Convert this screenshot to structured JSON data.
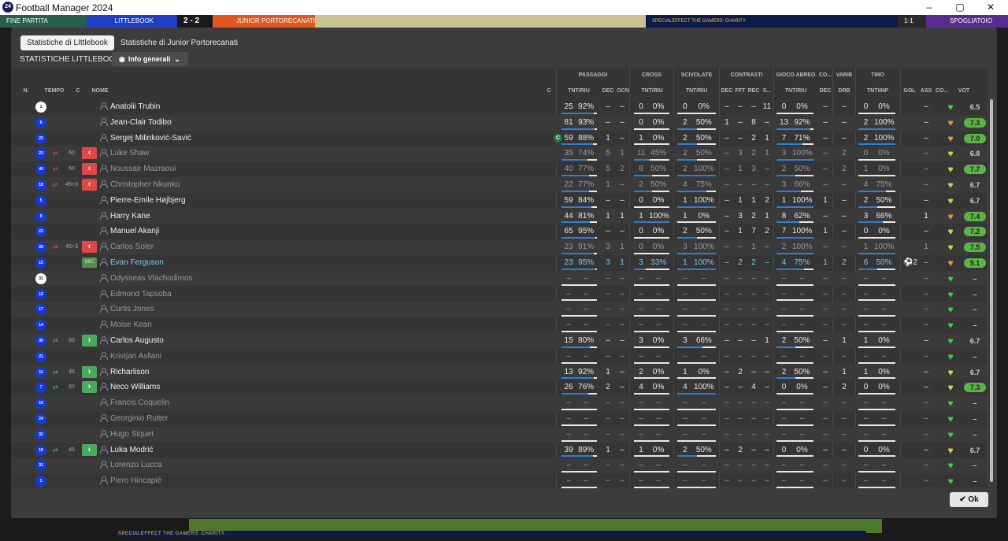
{
  "window": {
    "title": "Football Manager 2024",
    "logo": "24",
    "minimize": "–",
    "maximize": "▢",
    "close": "✕"
  },
  "topstrip": {
    "fine": "FINE PARTITA",
    "home": "LITTLEBOOK",
    "score": "2 - 2",
    "away": "JUNIOR PORTORECANATI",
    "ad": "SPECIALEFFECT THE GAMERS' CHARITY",
    "right1": "1-1",
    "right2": "SPOGLIATOIO"
  },
  "tabs": [
    "Statistiche di LIttlebook",
    "Statistiche di Junior Portorecanati"
  ],
  "section_title": "STATISTICHE LITTLEBOOK",
  "view_button": "Info generali",
  "group_headers": {
    "passaggi": "PASSAGGI",
    "cross": "CROSS",
    "scivolate": "SCIVOLATE",
    "contrasti": "CONTRASTI",
    "gioco_aereo": "GIOCO AEREO",
    "co": "CO...",
    "varie": "VARIE",
    "tiro": "TIRO"
  },
  "col_headers": {
    "n": "N.",
    "tempo": "TEMPO",
    "c": "C",
    "nome": "NOME",
    "cap": "C",
    "pass_tnt": "TNT/RIU",
    "pass_dec": "DEC",
    "pass_ocn": "OCN",
    "cross_tnt": "TNT/RIU",
    "sciv_tnt": "TNT/RIU",
    "con_dec": "DEC",
    "con_fft": "FFT",
    "con_rec": "REC",
    "con_s": "S...",
    "aer_tnt": "TNT/RIU",
    "co_dec": "DEC",
    "drb": "DRB",
    "tiro_tnt": "TNT\\INP",
    "gol": "GOL",
    "ass": "ASS",
    "co2": "CO...",
    "vot": "VOT"
  },
  "rows": [
    {
      "num": "1",
      "gk": true,
      "name": "Anatolii Trubin",
      "style": "n",
      "sub": "",
      "tempo": "",
      "badge": "",
      "cap": "",
      "p": [
        "25",
        "92%",
        0.92
      ],
      "pdec": "–",
      "pocn": "–",
      "cr": [
        "0",
        "0%",
        0
      ],
      "sc": [
        "0",
        "0%",
        0
      ],
      "cdec": "–",
      "cfft": "–",
      "crec": "–",
      "cs": "11",
      "ae": [
        "0",
        "0%",
        0
      ],
      "codec": "–",
      "drb": "–",
      "ti": [
        "0",
        "0%",
        0
      ],
      "gol": "",
      "ass": "–",
      "heart": "green",
      "vot": "6.5",
      "vc": "plain"
    },
    {
      "num": "6",
      "gk": false,
      "name": "Jean-Clair Todibo",
      "style": "n",
      "sub": "",
      "tempo": "",
      "badge": "",
      "cap": "",
      "p": [
        "81",
        "93%",
        0.93
      ],
      "pdec": "–",
      "pocn": "–",
      "cr": [
        "0",
        "0%",
        0
      ],
      "sc": [
        "2",
        "50%",
        0.5
      ],
      "cdec": "1",
      "cfft": "–",
      "crec": "8",
      "cs": "–",
      "ae": [
        "13",
        "92%",
        0.92
      ],
      "codec": "–",
      "drb": "–",
      "ti": [
        "2",
        "100%",
        1
      ],
      "gol": "",
      "ass": "–",
      "heart": "orange",
      "vot": "7.3",
      "vc": "#5ab546"
    },
    {
      "num": "22",
      "gk": false,
      "name": "Sergej Milinković-Savić",
      "style": "n",
      "sub": "",
      "tempo": "",
      "badge": "",
      "cap": "C",
      "p": [
        "59",
        "88%",
        0.88
      ],
      "pdec": "1",
      "pocn": "–",
      "cr": [
        "1",
        "0%",
        0
      ],
      "sc": [
        "2",
        "50%",
        0.5
      ],
      "cdec": "–",
      "cfft": "–",
      "crec": "2",
      "cs": "1",
      "ae": [
        "7",
        "71%",
        0.71
      ],
      "codec": "–",
      "drb": "–",
      "ti": [
        "2",
        "100%",
        1
      ],
      "gol": "",
      "ass": "–",
      "heart": "orange",
      "vot": "7.0",
      "vc": "#5ab546"
    },
    {
      "num": "23",
      "gk": false,
      "name": "Luke Shaw",
      "style": "d",
      "sub": "out",
      "tempo": "60",
      "badge": "out",
      "cap": "",
      "p": [
        "35",
        "74%",
        0.74
      ],
      "pdec": "5",
      "pocn": "1",
      "cr": [
        "11",
        "45%",
        0.45
      ],
      "sc": [
        "2",
        "50%",
        0.5
      ],
      "cdec": "–",
      "cfft": "3",
      "crec": "2",
      "cs": "1",
      "ae": [
        "3",
        "100%",
        1
      ],
      "codec": "–",
      "drb": "2",
      "ti": [
        "0",
        "0%",
        0
      ],
      "gol": "",
      "ass": "–",
      "heart": "yellow",
      "vot": "6.8",
      "vc": "plain"
    },
    {
      "num": "40",
      "gk": false,
      "name": "Noussair Mazraoui",
      "style": "d",
      "sub": "out",
      "tempo": "60",
      "badge": "out",
      "cap": "",
      "p": [
        "40",
        "77%",
        0.77
      ],
      "pdec": "5",
      "pocn": "2",
      "cr": [
        "8",
        "50%",
        0.5
      ],
      "sc": [
        "2",
        "100%",
        1
      ],
      "cdec": "–",
      "cfft": "1",
      "crec": "3",
      "cs": "–",
      "ae": [
        "2",
        "50%",
        0.5
      ],
      "codec": "–",
      "drb": "2",
      "ti": [
        "1",
        "0%",
        0
      ],
      "gol": "",
      "ass": "–",
      "heart": "yellow",
      "vot": "7.7",
      "vc": "#5ab546"
    },
    {
      "num": "18",
      "gk": false,
      "name": "Christopher Nkunku",
      "style": "d",
      "sub": "out",
      "tempo": "45+3",
      "badge": "out",
      "cap": "",
      "p": [
        "22",
        "77%",
        0.77
      ],
      "pdec": "1",
      "pocn": "–",
      "cr": [
        "2",
        "50%",
        0.5
      ],
      "sc": [
        "4",
        "75%",
        0.75
      ],
      "cdec": "–",
      "cfft": "–",
      "crec": "–",
      "cs": "–",
      "ae": [
        "3",
        "66%",
        0.66
      ],
      "codec": "–",
      "drb": "–",
      "ti": [
        "4",
        "75%",
        0.75
      ],
      "gol": "",
      "ass": "–",
      "heart": "yellow",
      "vot": "6.7",
      "vc": "plain"
    },
    {
      "num": "5",
      "gk": false,
      "name": "Pierre-Emile Højbjerg",
      "style": "n",
      "sub": "",
      "tempo": "",
      "badge": "",
      "cap": "",
      "p": [
        "59",
        "84%",
        0.84
      ],
      "pdec": "–",
      "pocn": "–",
      "cr": [
        "0",
        "0%",
        0
      ],
      "sc": [
        "1",
        "100%",
        1
      ],
      "cdec": "–",
      "cfft": "1",
      "crec": "1",
      "cs": "2",
      "ae": [
        "1",
        "100%",
        1
      ],
      "codec": "1",
      "drb": "–",
      "ti": [
        "2",
        "50%",
        0.5
      ],
      "gol": "",
      "ass": "–",
      "heart": "yellow",
      "vot": "6.7",
      "vc": "plain"
    },
    {
      "num": "9",
      "gk": false,
      "name": "Harry Kane",
      "style": "n",
      "sub": "",
      "tempo": "",
      "badge": "",
      "cap": "",
      "p": [
        "44",
        "81%",
        0.81
      ],
      "pdec": "1",
      "pocn": "1",
      "cr": [
        "1",
        "100%",
        1
      ],
      "sc": [
        "1",
        "0%",
        0
      ],
      "cdec": "–",
      "cfft": "3",
      "crec": "2",
      "cs": "1",
      "ae": [
        "8",
        "62%",
        0.62
      ],
      "codec": "–",
      "drb": "–",
      "ti": [
        "3",
        "66%",
        0.66
      ],
      "gol": "",
      "ass": "1",
      "heart": "orange",
      "vot": "7.4",
      "vc": "#5ab546"
    },
    {
      "num": "23",
      "gk": false,
      "name": "Manuel Akanji",
      "style": "n",
      "sub": "",
      "tempo": "",
      "badge": "",
      "cap": "",
      "p": [
        "65",
        "95%",
        0.95
      ],
      "pdec": "–",
      "pocn": "–",
      "cr": [
        "0",
        "0%",
        0
      ],
      "sc": [
        "2",
        "50%",
        0.5
      ],
      "cdec": "–",
      "cfft": "1",
      "crec": "7",
      "cs": "2",
      "ae": [
        "7",
        "100%",
        1
      ],
      "codec": "1",
      "drb": "–",
      "ti": [
        "0",
        "0%",
        0
      ],
      "gol": "",
      "ass": "–",
      "heart": "yellow",
      "vot": "7.2",
      "vc": "#5ab546"
    },
    {
      "num": "28",
      "gk": false,
      "name": "Carlos Soler",
      "style": "d",
      "sub": "out",
      "tempo": "45+3",
      "badge": "out",
      "cap": "",
      "p": [
        "23",
        "91%",
        0.91
      ],
      "pdec": "3",
      "pocn": "1",
      "cr": [
        "0",
        "0%",
        0
      ],
      "sc": [
        "3",
        "100%",
        1
      ],
      "cdec": "–",
      "cfft": "–",
      "crec": "1",
      "cs": "–",
      "ae": [
        "2",
        "100%",
        1
      ],
      "codec": "–",
      "drb": "–",
      "ti": [
        "1",
        "100%",
        1
      ],
      "gol": "",
      "ass": "1",
      "heart": "yellow",
      "vot": "7.5",
      "vc": "#5ab546"
    },
    {
      "num": "15",
      "gk": false,
      "name": "Evan Ferguson",
      "style": "h",
      "sub": "",
      "tempo": "",
      "badge": "MIC",
      "cap": "",
      "p": [
        "23",
        "95%",
        0.95
      ],
      "pdec": "3",
      "pocn": "1",
      "cr": [
        "3",
        "33%",
        0.33
      ],
      "sc": [
        "1",
        "100%",
        1
      ],
      "cdec": "–",
      "cfft": "2",
      "crec": "2",
      "cs": "–",
      "ae": [
        "4",
        "75%",
        0.75
      ],
      "codec": "1",
      "drb": "2",
      "ti": [
        "6",
        "50%",
        0.5
      ],
      "gol": "⚽2",
      "ass": "–",
      "heart": "orange",
      "vot": "9.1",
      "vc": "#5ab546"
    },
    {
      "num": "31",
      "gk": true,
      "name": "Odysseas Vlachodimos",
      "style": "d",
      "sub": "",
      "tempo": "",
      "badge": "",
      "cap": "",
      "p": [
        "–",
        "–",
        null
      ],
      "pdec": "–",
      "pocn": "–",
      "cr": [
        "–",
        "–",
        null
      ],
      "sc": [
        "–",
        "–",
        null
      ],
      "cdec": "–",
      "cfft": "–",
      "crec": "–",
      "cs": "–",
      "ae": [
        "–",
        "–",
        null
      ],
      "codec": "–",
      "drb": "–",
      "ti": [
        "–",
        "–",
        null
      ],
      "gol": "",
      "ass": "–",
      "heart": "green",
      "vot": "–",
      "vc": "plain"
    },
    {
      "num": "12",
      "gk": false,
      "name": "Edmond Tapsoba",
      "style": "d",
      "sub": "",
      "tempo": "",
      "badge": "",
      "cap": "",
      "p": [
        "–",
        "–",
        null
      ],
      "pdec": "–",
      "pocn": "–",
      "cr": [
        "–",
        "–",
        null
      ],
      "sc": [
        "–",
        "–",
        null
      ],
      "cdec": "–",
      "cfft": "–",
      "crec": "–",
      "cs": "–",
      "ae": [
        "–",
        "–",
        null
      ],
      "codec": "–",
      "drb": "–",
      "ti": [
        "–",
        "–",
        null
      ],
      "gol": "",
      "ass": "–",
      "heart": "green",
      "vot": "–",
      "vc": "plain"
    },
    {
      "num": "17",
      "gk": false,
      "name": "Curtis Jones",
      "style": "d",
      "sub": "",
      "tempo": "",
      "badge": "",
      "cap": "",
      "p": [
        "–",
        "–",
        null
      ],
      "pdec": "–",
      "pocn": "–",
      "cr": [
        "–",
        "–",
        null
      ],
      "sc": [
        "–",
        "–",
        null
      ],
      "cdec": "–",
      "cfft": "–",
      "crec": "–",
      "cs": "–",
      "ae": [
        "–",
        "–",
        null
      ],
      "codec": "–",
      "drb": "–",
      "ti": [
        "–",
        "–",
        null
      ],
      "gol": "",
      "ass": "–",
      "heart": "green",
      "vot": "–",
      "vc": "plain"
    },
    {
      "num": "14",
      "gk": false,
      "name": "Moise Kean",
      "style": "d",
      "sub": "",
      "tempo": "",
      "badge": "",
      "cap": "",
      "p": [
        "–",
        "–",
        null
      ],
      "pdec": "–",
      "pocn": "–",
      "cr": [
        "–",
        "–",
        null
      ],
      "sc": [
        "–",
        "–",
        null
      ],
      "cdec": "–",
      "cfft": "–",
      "crec": "–",
      "cs": "–",
      "ae": [
        "–",
        "–",
        null
      ],
      "codec": "–",
      "drb": "–",
      "ti": [
        "–",
        "–",
        null
      ],
      "gol": "",
      "ass": "–",
      "heart": "green",
      "vot": "–",
      "vc": "plain"
    },
    {
      "num": "30",
      "gk": false,
      "name": "Carlos Augusto",
      "style": "n",
      "sub": "in",
      "tempo": "60",
      "badge": "in",
      "cap": "",
      "p": [
        "15",
        "80%",
        0.8
      ],
      "pdec": "–",
      "pocn": "–",
      "cr": [
        "3",
        "0%",
        0
      ],
      "sc": [
        "3",
        "66%",
        0.66
      ],
      "cdec": "–",
      "cfft": "–",
      "crec": "–",
      "cs": "1",
      "ae": [
        "2",
        "50%",
        0.5
      ],
      "codec": "–",
      "drb": "1",
      "ti": [
        "1",
        "0%",
        0
      ],
      "gol": "",
      "ass": "–",
      "heart": "green",
      "vot": "6.7",
      "vc": "plain"
    },
    {
      "num": "21",
      "gk": false,
      "name": "Kristjan Asllani",
      "style": "d",
      "sub": "",
      "tempo": "",
      "badge": "",
      "cap": "",
      "p": [
        "–",
        "–",
        null
      ],
      "pdec": "–",
      "pocn": "–",
      "cr": [
        "–",
        "–",
        null
      ],
      "sc": [
        "–",
        "–",
        null
      ],
      "cdec": "–",
      "cfft": "–",
      "crec": "–",
      "cs": "–",
      "ae": [
        "–",
        "–",
        null
      ],
      "codec": "–",
      "drb": "–",
      "ti": [
        "–",
        "–",
        null
      ],
      "gol": "",
      "ass": "–",
      "heart": "green",
      "vot": "–",
      "vc": "plain"
    },
    {
      "num": "11",
      "gk": false,
      "name": "Richarlison",
      "style": "n",
      "sub": "in",
      "tempo": "45",
      "badge": "in",
      "cap": "",
      "p": [
        "13",
        "92%",
        0.92
      ],
      "pdec": "1",
      "pocn": "–",
      "cr": [
        "2",
        "0%",
        0
      ],
      "sc": [
        "1",
        "0%",
        0
      ],
      "cdec": "–",
      "cfft": "2",
      "crec": "–",
      "cs": "–",
      "ae": [
        "2",
        "50%",
        0.5
      ],
      "codec": "–",
      "drb": "1",
      "ti": [
        "1",
        "0%",
        0
      ],
      "gol": "",
      "ass": "–",
      "heart": "yellow",
      "vot": "6.7",
      "vc": "plain"
    },
    {
      "num": "7",
      "gk": false,
      "name": "Neco Williams",
      "style": "n",
      "sub": "in",
      "tempo": "60",
      "badge": "in",
      "cap": "",
      "p": [
        "26",
        "76%",
        0.76
      ],
      "pdec": "2",
      "pocn": "–",
      "cr": [
        "4",
        "0%",
        0
      ],
      "sc": [
        "4",
        "100%",
        1
      ],
      "cdec": "–",
      "cfft": "–",
      "crec": "4",
      "cs": "–",
      "ae": [
        "0",
        "0%",
        0
      ],
      "codec": "–",
      "drb": "2",
      "ti": [
        "0",
        "0%",
        0
      ],
      "gol": "",
      "ass": "–",
      "heart": "yellow",
      "vot": "7.3",
      "vc": "#5ab546"
    },
    {
      "num": "19",
      "gk": false,
      "name": "Francis Coquelin",
      "style": "d",
      "sub": "",
      "tempo": "",
      "badge": "",
      "cap": "",
      "p": [
        "–",
        "–",
        null
      ],
      "pdec": "–",
      "pocn": "–",
      "cr": [
        "–",
        "–",
        null
      ],
      "sc": [
        "–",
        "–",
        null
      ],
      "cdec": "–",
      "cfft": "–",
      "crec": "–",
      "cs": "–",
      "ae": [
        "–",
        "–",
        null
      ],
      "codec": "–",
      "drb": "–",
      "ti": [
        "–",
        "–",
        null
      ],
      "gol": "",
      "ass": "–",
      "heart": "green",
      "vot": "–",
      "vc": "plain"
    },
    {
      "num": "24",
      "gk": false,
      "name": "Georginio Rutter",
      "style": "d",
      "sub": "",
      "tempo": "",
      "badge": "",
      "cap": "",
      "p": [
        "–",
        "–",
        null
      ],
      "pdec": "–",
      "pocn": "–",
      "cr": [
        "–",
        "–",
        null
      ],
      "sc": [
        "–",
        "–",
        null
      ],
      "cdec": "–",
      "cfft": "–",
      "crec": "–",
      "cs": "–",
      "ae": [
        "–",
        "–",
        null
      ],
      "codec": "–",
      "drb": "–",
      "ti": [
        "–",
        "–",
        null
      ],
      "gol": "",
      "ass": "–",
      "heart": "green",
      "vot": "–",
      "vc": "plain"
    },
    {
      "num": "32",
      "gk": false,
      "name": "Hugo Siquet",
      "style": "d",
      "sub": "",
      "tempo": "",
      "badge": "",
      "cap": "",
      "p": [
        "–",
        "–",
        null
      ],
      "pdec": "–",
      "pocn": "–",
      "cr": [
        "–",
        "–",
        null
      ],
      "sc": [
        "–",
        "–",
        null
      ],
      "cdec": "–",
      "cfft": "–",
      "crec": "–",
      "cs": "–",
      "ae": [
        "–",
        "–",
        null
      ],
      "codec": "–",
      "drb": "–",
      "ti": [
        "–",
        "–",
        null
      ],
      "gol": "",
      "ass": "–",
      "heart": "green",
      "vot": "–",
      "vc": "plain"
    },
    {
      "num": "10",
      "gk": false,
      "name": "Luka Modrić",
      "style": "n",
      "sub": "in",
      "tempo": "45",
      "badge": "in",
      "cap": "",
      "p": [
        "39",
        "89%",
        0.89
      ],
      "pdec": "1",
      "pocn": "–",
      "cr": [
        "1",
        "0%",
        0
      ],
      "sc": [
        "2",
        "50%",
        0.5
      ],
      "cdec": "–",
      "cfft": "2",
      "crec": "–",
      "cs": "–",
      "ae": [
        "0",
        "0%",
        0
      ],
      "codec": "–",
      "drb": "–",
      "ti": [
        "0",
        "0%",
        0
      ],
      "gol": "",
      "ass": "–",
      "heart": "yellow",
      "vot": "6.7",
      "vc": "plain"
    },
    {
      "num": "31",
      "gk": false,
      "name": "Lorenzo Lucca",
      "style": "d",
      "sub": "",
      "tempo": "",
      "badge": "",
      "cap": "",
      "p": [
        "–",
        "–",
        null
      ],
      "pdec": "–",
      "pocn": "–",
      "cr": [
        "–",
        "–",
        null
      ],
      "sc": [
        "–",
        "–",
        null
      ],
      "cdec": "–",
      "cfft": "–",
      "crec": "–",
      "cs": "–",
      "ae": [
        "–",
        "–",
        null
      ],
      "codec": "–",
      "drb": "–",
      "ti": [
        "–",
        "–",
        null
      ],
      "gol": "",
      "ass": "–",
      "heart": "green",
      "vot": "–",
      "vc": "plain"
    },
    {
      "num": "3",
      "gk": false,
      "name": "Piero Hincapié",
      "style": "d",
      "sub": "",
      "tempo": "",
      "badge": "",
      "cap": "",
      "p": [
        "–",
        "–",
        null
      ],
      "pdec": "–",
      "pocn": "–",
      "cr": [
        "–",
        "–",
        null
      ],
      "sc": [
        "–",
        "–",
        null
      ],
      "cdec": "–",
      "cfft": "–",
      "crec": "–",
      "cs": "–",
      "ae": [
        "–",
        "–",
        null
      ],
      "codec": "–",
      "drb": "–",
      "ti": [
        "–",
        "–",
        null
      ],
      "gol": "",
      "ass": "–",
      "heart": "green",
      "vot": "–",
      "vc": "plain"
    }
  ],
  "ok_button": "Ok",
  "colors": {
    "accent_blue": "#2f7fd2",
    "rating_green": "#5ab546",
    "sub_out": "#e04848",
    "sub_in": "#4caa5f",
    "heart_green": "#3ecf4a",
    "heart_yellow": "#d9d23a",
    "heart_orange": "#e39a3a"
  }
}
